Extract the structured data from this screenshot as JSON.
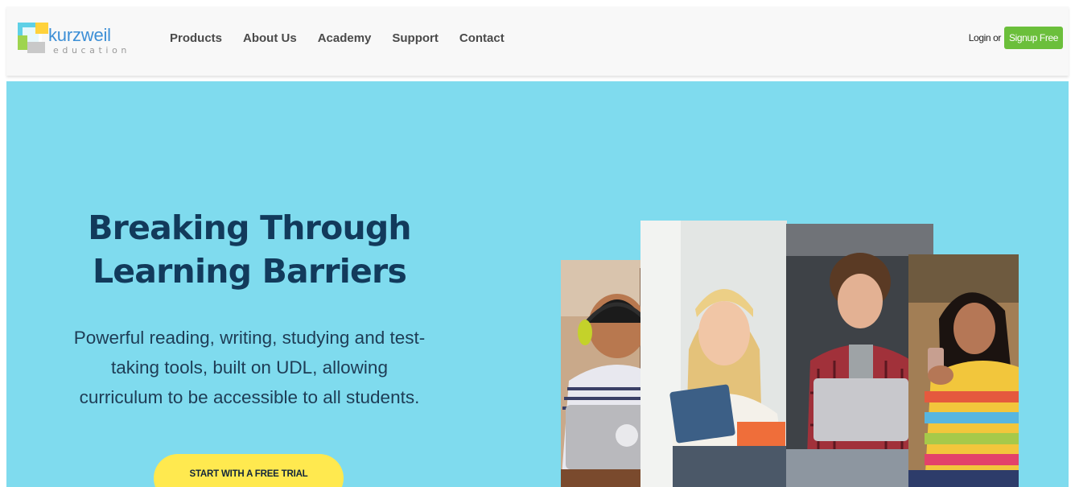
{
  "brand": {
    "name": "kurzweil",
    "tagline": "education",
    "colors": {
      "logo_blue": "#3d8fd6",
      "logo_yellow": "#ffd23c",
      "logo_green": "#9ed44f",
      "logo_cyan": "#5fd0e6"
    }
  },
  "nav": {
    "items": [
      {
        "label": "Products"
      },
      {
        "label": "About Us"
      },
      {
        "label": "Academy"
      },
      {
        "label": "Support"
      },
      {
        "label": "Contact"
      }
    ],
    "login_label": "Login",
    "or_label": "or",
    "signup_label": "Signup Free",
    "signup_color": "#6bbf3b"
  },
  "hero": {
    "title_line1": "Breaking Through",
    "title_line2": "Learning Barriers",
    "subtitle_line1": "Powerful reading, writing, studying and test-",
    "subtitle_line2": "taking tools, built on UDL, allowing",
    "subtitle_line3": "curriculum to be accessible to all students.",
    "cta_label": "START WITH A FREE TRIAL",
    "background": "#7fdbee",
    "title_color": "#123a5b",
    "cta_color": "#ffe94f"
  }
}
